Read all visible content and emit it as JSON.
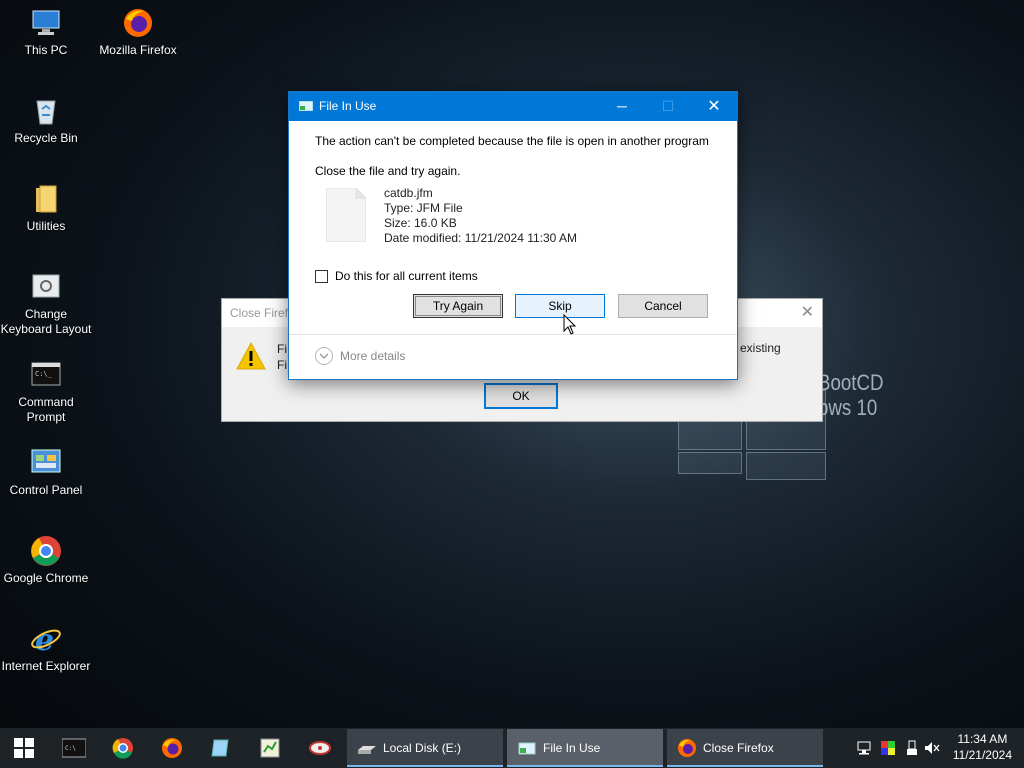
{
  "desktop": {
    "icons": [
      {
        "label": "This PC",
        "icon": "this-pc-icon"
      },
      {
        "label": "Mozilla Firefox",
        "icon": "firefox-icon"
      },
      {
        "label": "Recycle Bin",
        "icon": "recycle-bin-icon"
      },
      {
        "label": "Utilities",
        "icon": "folder-icon"
      },
      {
        "label": "Change Keyboard Layout",
        "icon": "keyboard-icon"
      },
      {
        "label": "Command Prompt",
        "icon": "command-prompt-icon"
      },
      {
        "label": "Control Panel",
        "icon": "control-panel-icon"
      },
      {
        "label": "Google Chrome",
        "icon": "chrome-icon"
      },
      {
        "label": "Internet Explorer",
        "icon": "ie-icon"
      }
    ],
    "wallpaper_text": [
      "BootCD",
      "ows 10"
    ]
  },
  "background_window": {
    "title": "Close Firefox",
    "title_visible": "Close Firef",
    "text_left": [
      "Fi",
      "Fi"
    ],
    "text_right": "existing",
    "ok_label": "OK"
  },
  "dialog": {
    "title": "File In Use",
    "message": "The action can't be completed because the file is open in another program",
    "instruction": "Close the file and try again.",
    "file": {
      "name": "catdb.jfm",
      "type": "Type: JFM File",
      "size": "Size: 16.0 KB",
      "modified": "Date modified: 11/21/2024 11:30 AM"
    },
    "checkbox_label": "Do this for all current items",
    "checkbox_checked": false,
    "buttons": {
      "try_again": "Try Again",
      "skip": "Skip",
      "cancel": "Cancel"
    },
    "more_details": "More details"
  },
  "taskbar": {
    "items": [
      {
        "label": "Local Disk (E:)",
        "icon": "drive-icon"
      },
      {
        "label": "File In Use",
        "icon": "file-in-use-icon"
      },
      {
        "label": "Close Firefox",
        "icon": "firefox-icon"
      }
    ],
    "clock": {
      "time": "11:34 AM",
      "date": "11/21/2024"
    }
  },
  "colors": {
    "accent": "#0078d7",
    "taskbar": "#1e2328"
  }
}
